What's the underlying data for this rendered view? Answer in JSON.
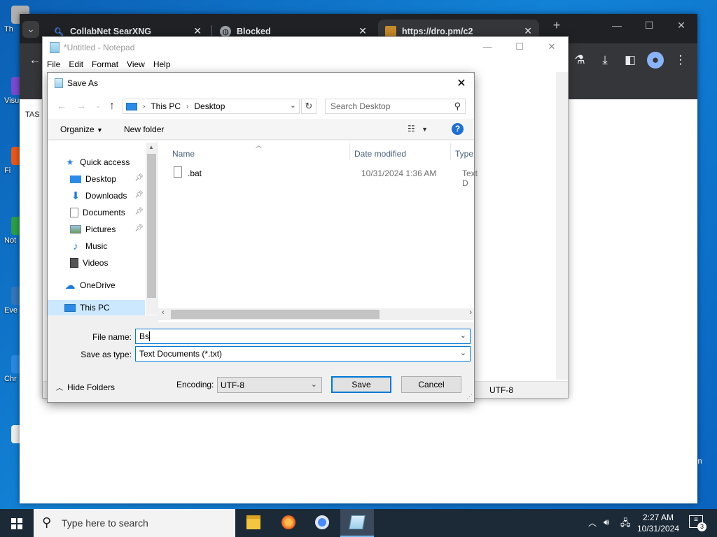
{
  "desktop": {
    "icons": [
      {
        "label": "Th",
        "color": "#b0b0b0"
      },
      {
        "label": "Visu",
        "color": "#7a4bd0"
      },
      {
        "label": "Fi",
        "color": "#e8581c"
      },
      {
        "label": "Not",
        "color": "#2c9e4b"
      },
      {
        "label": "Eve",
        "color": "#3277bc"
      },
      {
        "label": "Chr",
        "color": "#2a8ae0"
      },
      {
        "label": "",
        "color": "#eeeeee"
      }
    ]
  },
  "browser": {
    "tabs": [
      {
        "title": "CollabNet SearXNG",
        "icon": "search-icon"
      },
      {
        "title": "Blocked",
        "icon": "globe-icon"
      },
      {
        "title": "https://dro.pm/c2",
        "icon": "site-icon"
      }
    ],
    "new_tab": "+",
    "page_text": "TAS",
    "edge_text": "in"
  },
  "notepad": {
    "title": "*Untitled - Notepad",
    "menu": [
      "File",
      "Edit",
      "Format",
      "View",
      "Help"
    ],
    "status_encoding": "UTF-8"
  },
  "dialog": {
    "title": "Save As",
    "breadcrumb": [
      "This PC",
      "Desktop"
    ],
    "search_placeholder": "Search Desktop",
    "organize_label": "Organize",
    "new_folder_label": "New folder",
    "help_glyph": "?",
    "nav_items": [
      {
        "label": "Quick access",
        "icon": "star-icon",
        "pinned": false
      },
      {
        "label": "Desktop",
        "icon": "desktop-folder-icon",
        "pinned": true
      },
      {
        "label": "Downloads",
        "icon": "download-folder-icon",
        "pinned": true
      },
      {
        "label": "Documents",
        "icon": "documents-folder-icon",
        "pinned": true
      },
      {
        "label": "Pictures",
        "icon": "pictures-folder-icon",
        "pinned": true
      },
      {
        "label": "Music",
        "icon": "music-folder-icon",
        "pinned": false
      },
      {
        "label": "Videos",
        "icon": "videos-folder-icon",
        "pinned": false
      },
      {
        "label": "OneDrive",
        "icon": "cloud-icon",
        "pinned": false
      },
      {
        "label": "This PC",
        "icon": "computer-icon",
        "pinned": false
      }
    ],
    "columns": [
      "Name",
      "Date modified",
      "Type"
    ],
    "files": [
      {
        "name": ".bat",
        "date": "10/31/2024 1:36 AM",
        "type": "Text D"
      }
    ],
    "file_name_label": "File name:",
    "file_name_value": "Bs",
    "save_type_label": "Save as type:",
    "save_type_value": "Text Documents (*.txt)",
    "hide_folders_label": "Hide Folders",
    "encoding_label": "Encoding:",
    "encoding_value": "UTF-8",
    "save_label": "Save",
    "cancel_label": "Cancel"
  },
  "taskbar": {
    "search_placeholder": "Type here to search",
    "apps": [
      "file-explorer-icon",
      "firefox-icon",
      "chrome-icon",
      "notepad-icon"
    ],
    "time": "2:27 AM",
    "date": "10/31/2024",
    "notification_count": "3"
  }
}
